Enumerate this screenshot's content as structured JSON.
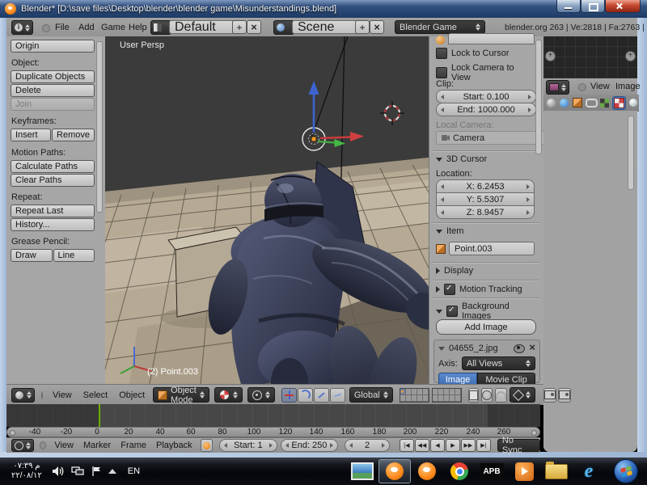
{
  "window": {
    "title": "Blender* [D:\\save files\\Desktop\\blender\\blender game\\Misunderstandings.blend]"
  },
  "top_header": {
    "menu_file": "File",
    "menu_add": "Add",
    "menu_game": "Game",
    "menu_help": "Help",
    "layout": "Default",
    "scene": "Scene",
    "engine": "Blender Game",
    "stats": "blender.org 263 | Ve:2818 | Fa:2763 | Ob:1-10"
  },
  "tool_shelf": {
    "origin": "Origin",
    "object_label": "Object:",
    "duplicate": "Duplicate Objects",
    "delete": "Delete",
    "join": "Join",
    "keyframes_label": "Keyframes:",
    "insert": "Insert",
    "remove": "Remove",
    "motion_label": "Motion Paths:",
    "calculate": "Calculate Paths",
    "clear": "Clear Paths",
    "repeat_label": "Repeat:",
    "repeat_last": "Repeat Last",
    "history": "History...",
    "grease_label": "Grease Pencil:",
    "draw": "Draw",
    "line": "Line"
  },
  "viewport": {
    "view_label": "User Persp",
    "selection_label": "(2) Point.003"
  },
  "n_panel": {
    "lock_to_cursor": "Lock to Cursor",
    "lock_camera": "Lock Camera to View",
    "clip_label": "Clip:",
    "clip_start": "Start: 0.100",
    "clip_end": "End: 1000.000",
    "local_camera_label": "Local Camera:",
    "camera": "Camera",
    "cursor_header": "3D Cursor",
    "location_label": "Location:",
    "loc_x": "X: 6.2453",
    "loc_y": "Y: 5.5307",
    "loc_z": "Z: 8.9457",
    "item_header": "Item",
    "item_name": "Point.003",
    "display_header": "Display",
    "motion_tracking_header": "Motion Tracking",
    "background_header": "Background Images",
    "add_image": "Add Image",
    "image_name": "04655_2.jpg",
    "axis_label": "Axis:",
    "axis_value": "All Views",
    "image_btn": "Image",
    "movie_btn": "Movie Clip"
  },
  "image_editor": {
    "menu_view": "View",
    "menu_image": "Image"
  },
  "view3d_header": {
    "menu_view": "View",
    "menu_select": "Select",
    "menu_object": "Object",
    "mode": "Object Mode",
    "orientation": "Global"
  },
  "timeline": {
    "ruler": [
      "-40",
      "-20",
      "0",
      "20",
      "40",
      "60",
      "80",
      "100",
      "120",
      "140",
      "160",
      "180",
      "200",
      "220",
      "240",
      "260"
    ],
    "menu_view": "View",
    "menu_marker": "Marker",
    "menu_frame": "Frame",
    "menu_playback": "Playback",
    "start": "Start: 1",
    "end": "End: 250",
    "current_frame": "2",
    "playback": [
      "|◀",
      "◀◀",
      "◀",
      "▶",
      "▶▶",
      "▶|"
    ],
    "sync": "No Sync"
  },
  "taskbar": {
    "clock_time": "م ٠٧:٣٩",
    "clock_date": "٢٢/٠٨/١٢",
    "language": "EN",
    "apb_label": "APB"
  },
  "colors": {
    "accent_blue": "#4a7cc7",
    "playhead_green": "#6ab004",
    "blender_orange": "#ff7f1f"
  }
}
